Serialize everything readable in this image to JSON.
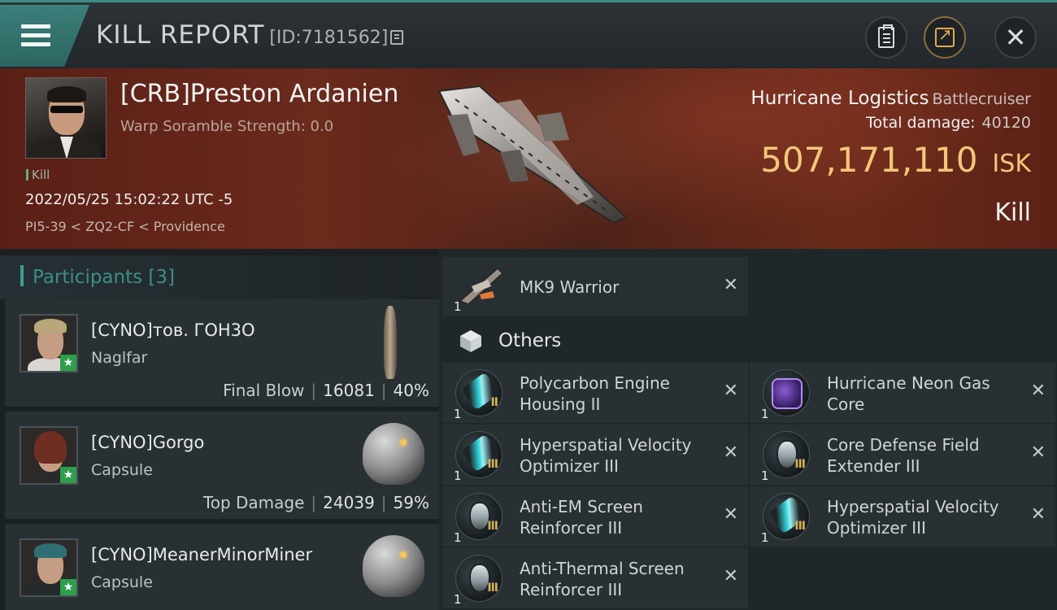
{
  "header": {
    "title": "KILL REPORT",
    "id_text": "[ID:7181562]",
    "icons": [
      "menu-icon",
      "copy-icon",
      "clipboard-icon",
      "share-icon",
      "close-icon"
    ],
    "accent_color": "#3f8c87"
  },
  "victim": {
    "name": "[CRB]Preston Ardanien",
    "warp_text": "Warp Soramble Strength: 0.0",
    "tag": "Kill",
    "datetime": "2022/05/25 15:02:22 UTC -5",
    "location": "PI5-39 < ZQ2-CF < Providence",
    "ship_name": "Hurricane Logistics",
    "ship_class": "Battlecruiser",
    "total_damage_label": "Total damage:",
    "total_damage": "40120",
    "isk_value": "507,171,110",
    "isk_unit": "ISK",
    "result": "Kill",
    "isk_color": "#f3c77a"
  },
  "participants": {
    "label": "Participants",
    "count": "[3]",
    "rows": [
      {
        "name": "[CYNO]тов. ГОН3О",
        "ship": "Naglfar",
        "stat_label": "Final Blow",
        "damage": "16081",
        "percent": "40%"
      },
      {
        "name": "[CYNO]Gorgo",
        "ship": "Capsule",
        "stat_label": "Top Damage",
        "damage": "24039",
        "percent": "59%"
      },
      {
        "name": "[CYNO]MeanerMinorMiner",
        "ship": "Capsule"
      }
    ]
  },
  "items": {
    "drone": {
      "qty": "1",
      "name": "MK9  Warrior"
    },
    "others_label": "Others",
    "list_a": [
      {
        "qty": "1",
        "name": "Polycarbon Engine Housing II",
        "tech": "II"
      },
      {
        "qty": "1",
        "name": "Hyperspatial Velocity Optimizer III",
        "tech": "III"
      },
      {
        "qty": "1",
        "name": "Anti-EM Screen Reinforcer III",
        "tech": "III"
      },
      {
        "qty": "1",
        "name": "Anti-Thermal Screen Reinforcer III",
        "tech": "III"
      }
    ],
    "list_b": [
      {
        "qty": "1",
        "name": "Hurricane Neon Gas Core",
        "tech": ""
      },
      {
        "qty": "1",
        "name": "Core Defense Field Extender III",
        "tech": "III"
      },
      {
        "qty": "1",
        "name": "Hyperspatial Velocity Optimizer III",
        "tech": "III"
      }
    ],
    "remove_glyph": "✕"
  }
}
